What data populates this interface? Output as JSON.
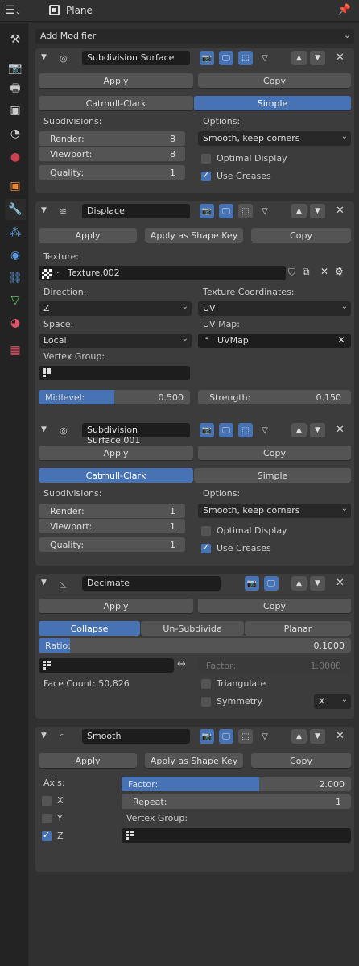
{
  "header": {
    "title": "Plane"
  },
  "add_modifier": "Add Modifier",
  "common": {
    "apply": "Apply",
    "copy": "Copy",
    "apply_shape_key": "Apply as Shape Key"
  },
  "subsurf1": {
    "name": "Subdivision Surface",
    "mode_catmull": "Catmull-Clark",
    "mode_simple": "Simple",
    "selected_mode": "Simple",
    "subdivisions_label": "Subdivisions:",
    "options_label": "Options:",
    "render_label": "Render:",
    "render_value": "8",
    "viewport_label": "Viewport:",
    "viewport_value": "8",
    "quality_label": "Quality:",
    "quality_value": "1",
    "uv_smooth": "Smooth, keep corners",
    "optimal_display": "Optimal Display",
    "optimal_display_checked": false,
    "use_creases": "Use Creases",
    "use_creases_checked": true
  },
  "displace": {
    "name": "Displace",
    "texture_label": "Texture:",
    "texture_value": "Texture.002",
    "direction_label": "Direction:",
    "direction_value": "Z",
    "tex_coords_label": "Texture Coordinates:",
    "tex_coords_value": "UV",
    "space_label": "Space:",
    "space_value": "Local",
    "uvmap_label": "UV Map:",
    "uvmap_value": "UVMap",
    "vertex_group_label": "Vertex Group:",
    "midlevel_label": "Midlevel:",
    "midlevel_value": "0.500",
    "midlevel_fraction": 0.5,
    "strength_label": "Strength:",
    "strength_value": "0.150"
  },
  "subsurf2": {
    "name": "Subdivision Surface.001",
    "mode_catmull": "Catmull-Clark",
    "mode_simple": "Simple",
    "selected_mode": "Catmull-Clark",
    "subdivisions_label": "Subdivisions:",
    "options_label": "Options:",
    "render_label": "Render:",
    "render_value": "1",
    "viewport_label": "Viewport:",
    "viewport_value": "1",
    "quality_label": "Quality:",
    "quality_value": "1",
    "uv_smooth": "Smooth, keep corners",
    "optimal_display": "Optimal Display",
    "optimal_display_checked": false,
    "use_creases": "Use Creases",
    "use_creases_checked": true
  },
  "decimate": {
    "name": "Decimate",
    "mode_collapse": "Collapse",
    "mode_unsubdivide": "Un-Subdivide",
    "mode_planar": "Planar",
    "selected_mode": "Collapse",
    "ratio_label": "Ratio:",
    "ratio_value": "0.1000",
    "ratio_fraction": 0.1,
    "factor_label": "Factor:",
    "factor_value": "1.0000",
    "face_count": "Face Count: 50,826",
    "triangulate": "Triangulate",
    "triangulate_checked": false,
    "symmetry": "Symmetry",
    "symmetry_checked": false,
    "symmetry_axis": "X"
  },
  "smooth": {
    "name": "Smooth",
    "axis_label": "Axis:",
    "axis_x": "X",
    "axis_y": "Y",
    "axis_z": "Z",
    "axis_x_checked": false,
    "axis_y_checked": false,
    "axis_z_checked": true,
    "factor_label": "Factor:",
    "factor_value": "2.000",
    "factor_fraction": 0.6,
    "repeat_label": "Repeat:",
    "repeat_value": "1",
    "vertex_group_label": "Vertex Group:"
  },
  "colors": {
    "accent": "#4772b3",
    "panel": "#3c3c3c",
    "background": "#303030"
  }
}
